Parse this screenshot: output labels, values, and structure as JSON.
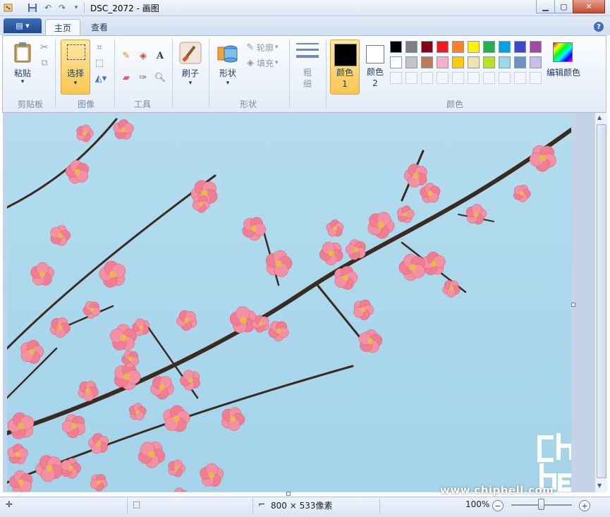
{
  "window": {
    "title": "DSC_2072 - 画图"
  },
  "tabs": {
    "home": "主页",
    "view": "查看"
  },
  "clipboard": {
    "paste_label": "粘贴",
    "group_label": "剪贴板"
  },
  "image": {
    "select_label": "选择",
    "group_label": "图像"
  },
  "tools": {
    "group_label": "工具"
  },
  "brushes": {
    "label": "刷子"
  },
  "shapes": {
    "shapes_label": "形状",
    "outline_label": "轮廓",
    "fill_label": "填充",
    "group_label": "形状"
  },
  "size": {
    "label": "粗细"
  },
  "colors": {
    "color1_label": "颜色 1",
    "color2_label": "颜色 2",
    "edit_label": "编辑颜色",
    "group_label": "颜色",
    "color1": "#000000",
    "color2": "#ffffff",
    "palette_row1": [
      "#000000",
      "#7f7f7f",
      "#880015",
      "#ed1c24",
      "#ff7f27",
      "#fff200",
      "#22b14c",
      "#00a2e8",
      "#3f48cc",
      "#a349a4"
    ],
    "palette_row2": [
      "#ffffff",
      "#c3c3c3",
      "#b97a57",
      "#ffaec9",
      "#ffc90e",
      "#efe4b0",
      "#b5e61d",
      "#99d9ea",
      "#7092be",
      "#c8bfe7"
    ]
  },
  "status": {
    "dimensions": "800 × 533像素",
    "zoom": "100%"
  },
  "watermark": {
    "text": "www.chiphell.com",
    "logo": "chip hell"
  }
}
